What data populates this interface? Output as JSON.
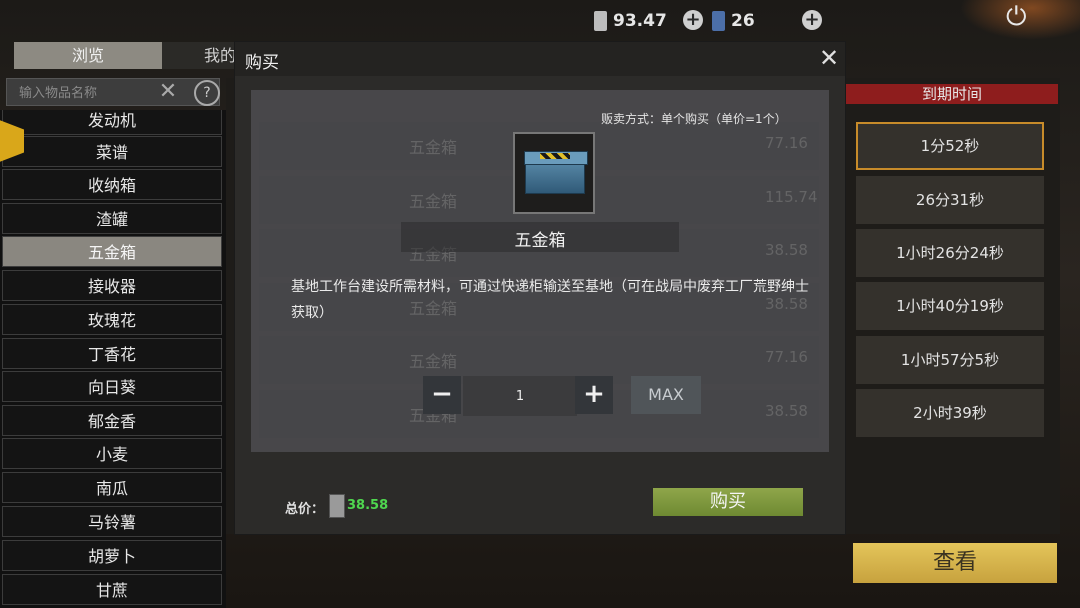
{
  "topbar": {
    "currency1": "93.47",
    "currency2": "26",
    "plus": "+",
    "power_icon": "⏻"
  },
  "tabs": {
    "browse": "浏览",
    "mine": "我的"
  },
  "search": {
    "placeholder": "输入物品名称",
    "clear": "✕",
    "help": "?"
  },
  "categories": [
    "发动机",
    "菜谱",
    "收纳箱",
    "渣罐",
    "五金箱",
    "接收器",
    "玫瑰花",
    "丁香花",
    "向日葵",
    "郁金香",
    "小麦",
    "南瓜",
    "马铃薯",
    "胡萝卜",
    "甘蔗"
  ],
  "listing": {
    "col_expire": "到期时间",
    "rows": [
      {
        "name": "五金箱",
        "price": "77.16",
        "expire": "1分52秒"
      },
      {
        "name": "五金箱",
        "price": "115.74",
        "expire": "26分31秒"
      },
      {
        "name": "五金箱",
        "price": "38.58",
        "expire": "1小时26分24秒"
      },
      {
        "name": "五金箱",
        "price": "38.58",
        "expire": "1小时40分19秒"
      },
      {
        "name": "五金箱",
        "price": "77.16",
        "expire": "1小时57分5秒"
      },
      {
        "name": "五金箱",
        "price": "38.58",
        "expire": "2小时39秒"
      }
    ],
    "view_button": "查看"
  },
  "modal": {
    "title": "购买",
    "close": "✕",
    "sale_mode": "贩卖方式：单个购买（单价=1个）",
    "item_name": "五金箱",
    "description": "基地工作台建设所需材料，可通过快递柜输送至基地（可在战局中废弃工厂荒野绅士获取）",
    "qty_minus": "−",
    "qty_plus": "+",
    "qty_value": "1",
    "qty_max": "MAX",
    "total_label": "总价：",
    "total_value": "38.58",
    "buy_button": "购买"
  },
  "colors": {
    "accent_buy": "#7a9a3a",
    "view_button": "#d8b84e",
    "expire_header": "#8e1d1d",
    "selected_row": "#c78b2a",
    "total_value": "#4fd64f"
  }
}
